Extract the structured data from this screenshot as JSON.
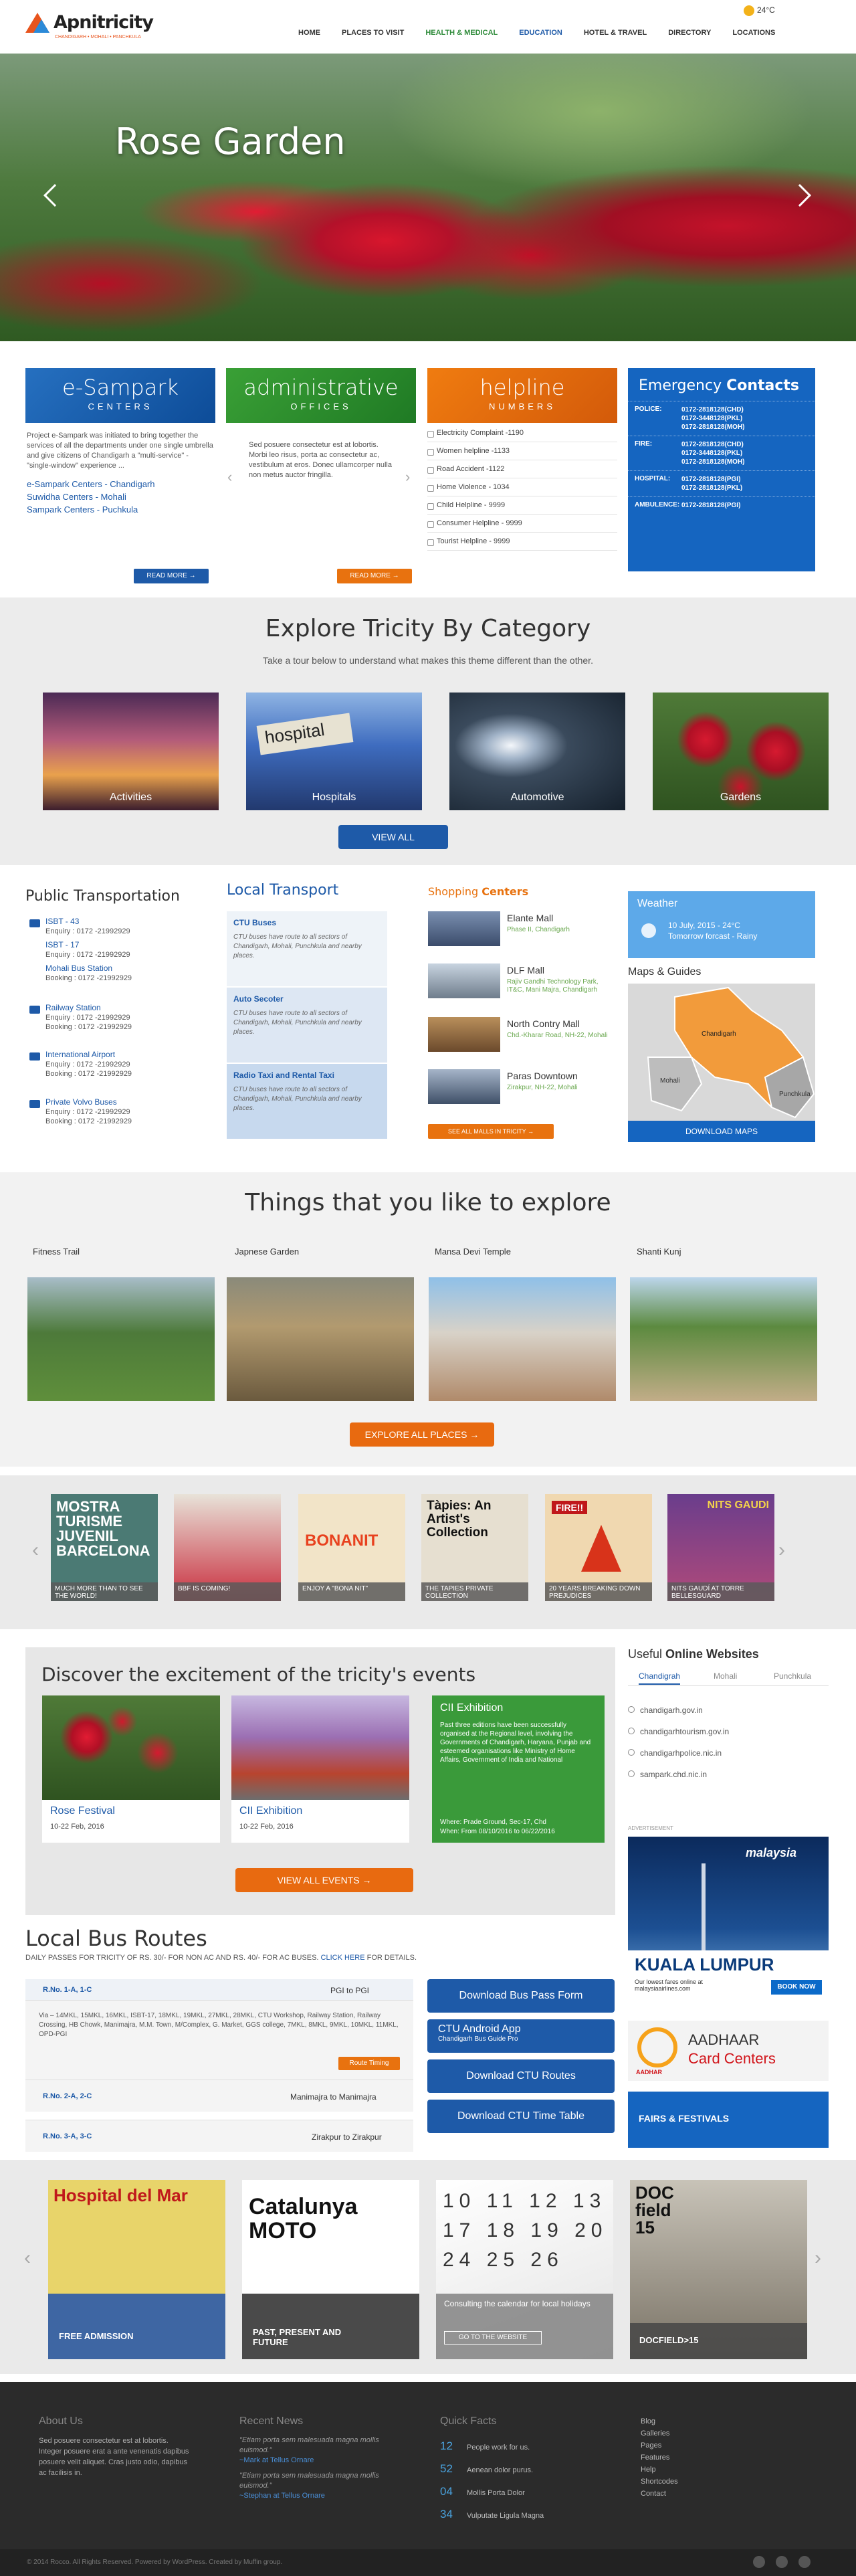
{
  "header": {
    "logo": "Apnitricity",
    "tagline": "CHANDIGARH • MOHALI • PANCHKULA",
    "nav": [
      "HOME",
      "PLACES TO VISIT",
      "HEALTH & MEDICAL",
      "EDUCATION",
      "HOTEL & TRAVEL",
      "DIRECTORY",
      "LOCATIONS"
    ],
    "temp": "24°C"
  },
  "hero": {
    "title": "Rose Garden"
  },
  "boxes": {
    "esampark": {
      "t1": "e-Sampark",
      "t2": "CENTERS",
      "text": "Project e-Sampark was initiated to bring together the services of all the departments under one single umbrella and give citizens of Chandigarh a \"multi-service\" - \"single-window\" experience ...",
      "links": [
        "e-Sampark Centers - Chandigarh",
        "Suwidha Centers - Mohali",
        "Sampark Centers - Puchkula"
      ],
      "btn": "READ MORE"
    },
    "admin": {
      "t1": "administrative",
      "t2": "OFFICES",
      "text": "Sed posuere consectetur est at lobortis. Morbi leo risus, porta ac consectetur ac, vestibulum at eros. Donec ullamcorper nulla non metus auctor fringilla.",
      "btn": "READ MORE"
    },
    "helpline": {
      "t1": "helpline",
      "t2": "NUMBERS",
      "items": [
        "Electricity Complaint -1190",
        "Women helpline -1133",
        "Road Accident -1122",
        "Home Violence - 1034",
        "Child Helpline - 9999",
        "Consumer Helpline - 9999",
        "Tourist Helpline - 9999"
      ]
    },
    "emergency": {
      "t1": "Emergency",
      "t2": "Contacts",
      "rows": [
        {
          "k": "POLICE:",
          "v": [
            "0172-2818128(CHD)",
            "0172-3448128(PKL)",
            "0172-2818128(MOH)"
          ]
        },
        {
          "k": "FIRE:",
          "v": [
            "0172-2818128(CHD)",
            "0172-3448128(PKL)",
            "0172-2818128(MOH)"
          ]
        },
        {
          "k": "HOSPITAL:",
          "v": [
            "0172-2818128(PGI)",
            "0172-2818128(PKL)"
          ]
        },
        {
          "k": "AMBULENCE:",
          "v": [
            "0172-2818128(PGI)"
          ]
        }
      ]
    }
  },
  "category": {
    "title": "Explore Tricity By Category",
    "sub": "Take a tour below to understand what makes this theme different than the other.",
    "cards": [
      "Activities",
      "Hospitals",
      "Automotive",
      "Gardens"
    ],
    "btn": "VIEW ALL"
  },
  "transport": {
    "title1": "Public",
    "title2": "Transportation",
    "items": [
      {
        "n": "ISBT - 43",
        "l": "Enquiry : 0172 -21992929"
      },
      {
        "n": "ISBT - 17",
        "l": "Enquiry : 0172 -21992929"
      },
      {
        "n": "Mohali Bus Station",
        "l": "Booking : 0172 -21992929"
      },
      {
        "n": "Railway Station",
        "l": "Enquiry : 0172 -21992929",
        "l2": "Booking : 0172 -21992929"
      },
      {
        "n": "International Airport",
        "l": "Enquiry : 0172 -21992929",
        "l2": "Booking : 0172 -21992929"
      },
      {
        "n": "Private Volvo Buses",
        "l": "Enquiry : 0172 -21992929",
        "l2": "Booking : 0172 -21992929"
      }
    ]
  },
  "local": {
    "title1": "Local",
    "title2": "Transport",
    "items": [
      {
        "h": "CTU Buses",
        "d": "CTU buses have route to all sectors of Chandigarh, Mohali, Punchkula and nearby places."
      },
      {
        "h": "Auto Secoter",
        "d": "CTU buses have route to all sectors of Chandigarh, Mohali, Punchkula and nearby places."
      },
      {
        "h": "Radio Taxi and Rental Taxi",
        "d": "CTU buses have route to all sectors of Chandigarh, Mohali, Punchkula and nearby places."
      }
    ]
  },
  "shopping": {
    "title1": "Shopping",
    "title2": "Centers",
    "items": [
      {
        "n": "Elante Mall",
        "s": "Phase II, Chandigarh"
      },
      {
        "n": "DLF Mall",
        "s": "Rajiv Gandhi Technology Park, IT&C, Mani Majra, Chandigarh"
      },
      {
        "n": "North Contry Mall",
        "s": "Chd.-Kharar Road, NH-22, Mohali"
      },
      {
        "n": "Paras Downtown",
        "s": "Zirakpur, NH-22, Mohali"
      }
    ],
    "btn": "SEE ALL MALLS IN TRICITY"
  },
  "weather": {
    "title": "Weather",
    "line1": "10 July, 2015 - 24°C",
    "line2": "Tomorrow forcast - Rainy"
  },
  "maps": {
    "title": "Maps & Guides",
    "labels": [
      "Chandigarh",
      "Mohali",
      "Punchkula"
    ],
    "btn": "DOWNLOAD MAPS"
  },
  "things": {
    "title": "Things that you like to explore",
    "items": [
      "Fitness Trail",
      "Japnese Garden",
      "Mansa Devi Temple",
      "Shanti Kunj"
    ],
    "btn": "EXPLORE ALL PLACES"
  },
  "strip": {
    "cards": [
      {
        "big": "MOSTRA TURISME JUVENIL BARCELONA",
        "cap": "MUCH MORE THAN TO SEE THE WORLD!"
      },
      {
        "big": "",
        "cap": "BBF IS COMING!"
      },
      {
        "big": "BONANIT",
        "cap": "ENJOY A \"BONA NIT\""
      },
      {
        "big": "Tàpies: An Artist's Collection",
        "cap": "THE TAPIES PRIVATE COLLECTION"
      },
      {
        "big": "FIRE!!",
        "cap": "20 YEARS BREAKING DOWN PREJUDICES"
      },
      {
        "big": "NITS GAUDI",
        "cap": "NITS GAUDÍ AT TORRE BELLESGUARD"
      }
    ]
  },
  "events": {
    "title": "Discover the excitement of the tricity's events",
    "e1": {
      "n": "Rose Festival",
      "d": "10-22 Feb, 2016"
    },
    "e2": {
      "n": "CII Exhibition",
      "d": "10-22 Feb, 2016"
    },
    "feat": {
      "n": "CII Exhibition",
      "text": "Past three editions have been successfully organised at the Regional level, involving the Governments of Chandigarh, Haryana, Punjab and esteemed organisations like Ministry of Home Affairs, Government of India and National",
      "where": "Where: Prade Ground, Sec-17, Chd",
      "when": "When: From 08/10/2016 to 06/22/2016"
    },
    "btn": "VIEW ALL EVENTS"
  },
  "websites": {
    "t1": "Useful",
    "t2": "Online Websites",
    "tabs": [
      "Chandigrah",
      "Mohali",
      "Punchkula"
    ],
    "items": [
      "chandigarh.gov.in",
      "chandigarhtourism.gov.in",
      "chandigarhpolice.nic.in",
      "sampark.chd.nic.in"
    ]
  },
  "ad": {
    "label": "ADVERTISEMENT",
    "brand": "malaysia",
    "city": "KUALA LUMPUR",
    "btn": "BOOK NOW",
    "note": "Our lowest fares online at malaysiaairlines.com"
  },
  "aadhaar": {
    "t1": "AADHAAR",
    "t2": "Card Centers",
    "logo": "AADHAR"
  },
  "fairs": "FAIRS & FESTIVALS",
  "bus": {
    "title": "Local Bus Routes",
    "sub": "DAILY PASSES FOR TRICITY OF RS. 30/- FOR NON AC AND RS. 40/- FOR AC BUSES.",
    "link": "CLICK HERE",
    "sub2": "FOR DETAILS.",
    "r1": {
      "n": "R.No. 1-A, 1-C",
      "to": "PGI to PGI",
      "via": "Via – 14MKL, 15MKL, 16MKL, ISBT-17, 18MKL, 19MKL, 27MKL, 28MKL, CTU Workshop, Railway Station, Railway Crossing, HB Chowk, Manimajra, M.M. Town, M/Complex, G. Market, GGS college, 7MKL, 8MKL, 9MKL, 10MKL, 11MKL, OPD-PGI",
      "btn": "Route Timing"
    },
    "r2": {
      "n": "R.No. 2-A, 2-C",
      "to": "Manimajra to Manimajra"
    },
    "r3": {
      "n": "R.No. 3-A, 3-C",
      "to": "Zirakpur to Zirakpur"
    },
    "buttons": [
      "Download Bus Pass Form",
      "CTU Android App",
      "Chandigarh Bus Guide Pro",
      "Download CTU Routes",
      "Download CTU Time Table"
    ]
  },
  "bottomcards": [
    {
      "big": "Hospital del Mar",
      "cap": "FREE ADMISSION"
    },
    {
      "big": "Catalunya MOTO",
      "cap": "PAST, PRESENT AND FUTURE"
    },
    {
      "big": "",
      "cap": "Consulting the calendar for local holidays",
      "btn": "GO TO THE WEBSITE"
    },
    {
      "big": "DOC field 15",
      "cap": "DOCFIELD>15"
    }
  ],
  "footer": {
    "about": {
      "title": "About Us",
      "text": "Sed posuere consectetur est at lobortis. Integer posuere erat a ante venenatis dapibus posuere velit aliquet. Cras justo odio, dapibus ac facilisis in."
    },
    "news": {
      "title": "Recent News",
      "items": [
        {
          "q": "\"Etiam porta sem malesuada magna mollis euismod.\"",
          "a": "~Mark at Tellus Ornare"
        },
        {
          "q": "\"Etiam porta sem malesuada magna mollis euismod.\"",
          "a": "~Stephan at Tellus Ornare"
        }
      ]
    },
    "facts": {
      "title": "Quick Facts",
      "items": [
        {
          "n": "12",
          "t": "People work for us."
        },
        {
          "n": "52",
          "t": "Aenean dolor purus."
        },
        {
          "n": "04",
          "t": "Mollis Porta Dolor"
        },
        {
          "n": "34",
          "t": "Vulputate Ligula Magna"
        }
      ]
    },
    "links": [
      "Blog",
      "Galleries",
      "Pages",
      "Features",
      "Help",
      "Shortcodes",
      "Contact"
    ],
    "copy": "© 2014 Rocco. All Rights Reserved. Powered by WordPress. Created by Muffin group."
  }
}
